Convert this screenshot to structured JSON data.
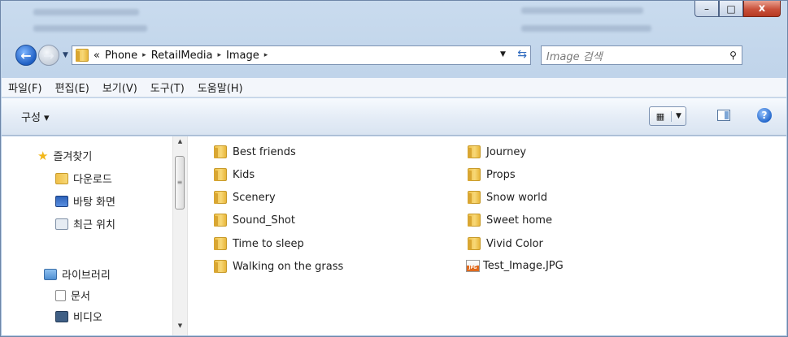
{
  "window": {
    "caption_buttons": {
      "minimize": "–",
      "maximize": "□",
      "close": "x"
    }
  },
  "address": {
    "overflow": "«",
    "crumbs": [
      "Phone",
      "RetailMedia",
      "Image"
    ],
    "separator": "▸"
  },
  "search": {
    "placeholder": "Image 검색"
  },
  "menu": [
    "파일(F)",
    "편집(E)",
    "보기(V)",
    "도구(T)",
    "도움말(H)"
  ],
  "toolbar": {
    "organize_label": "구성 ▾",
    "help_label": "?"
  },
  "navpane": {
    "favorites": {
      "label": "즐겨찾기",
      "items": [
        "다운로드",
        "바탕 화면",
        "최근 위치"
      ]
    },
    "libraries": {
      "label": "라이브러리",
      "items": [
        "문서",
        "비디오"
      ]
    }
  },
  "files": {
    "column1": [
      "Best friends",
      "Kids",
      "Scenery",
      "Sound_Shot",
      "Time to sleep",
      "Walking on the grass"
    ],
    "column2": [
      "Journey",
      "Props",
      "Snow world",
      "Sweet home",
      "Vivid Color",
      "Test_Image.JPG"
    ]
  },
  "colors": {
    "accent": "#1f5fc4",
    "folder": "#f0c048",
    "close_button": "#c9503a"
  }
}
